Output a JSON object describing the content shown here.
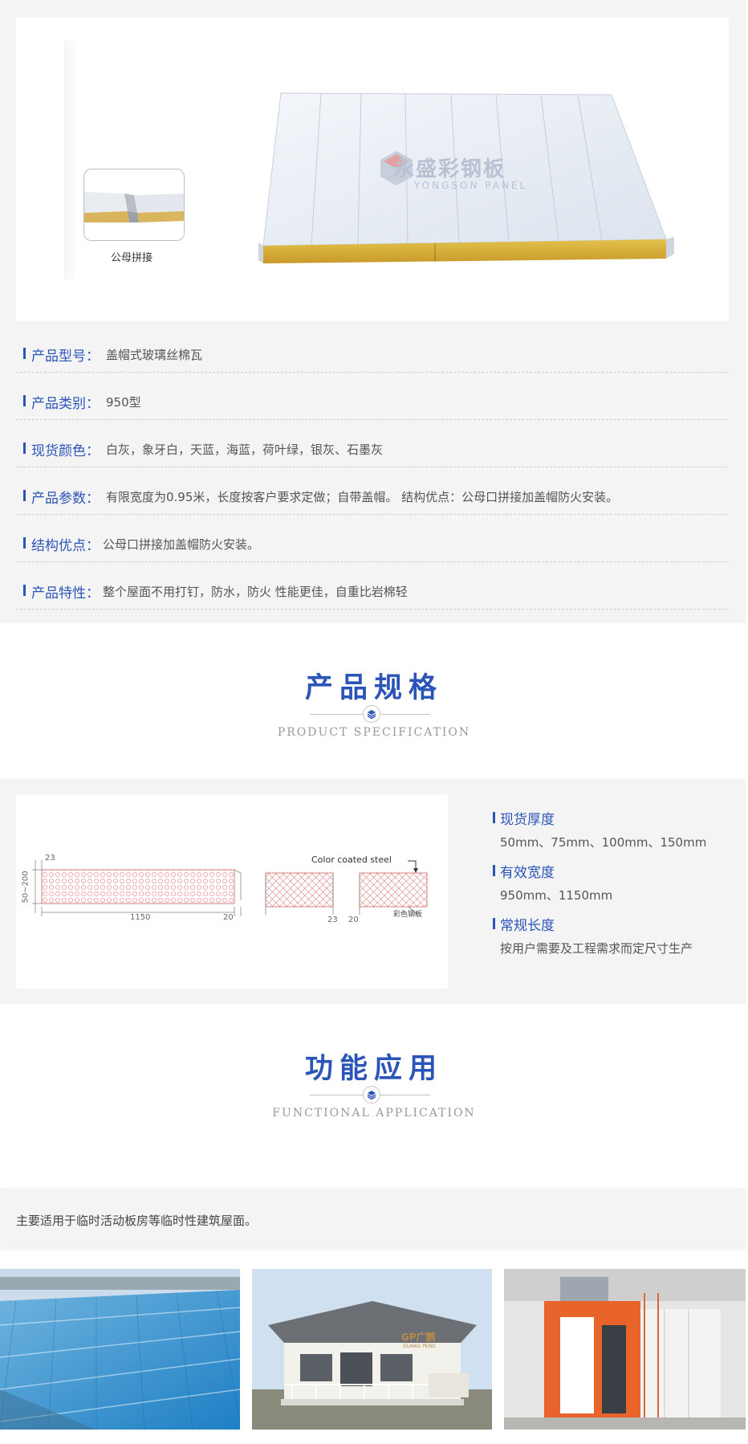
{
  "product_image": {
    "watermark_cn": "永盛彩钢板",
    "watermark_en": "YONGSON PANEL",
    "inset_caption": "公母拼接"
  },
  "specs": [
    {
      "label": "产品型号：",
      "value": "盖帽式玻璃丝棉瓦"
    },
    {
      "label": "产品类别：",
      "value": "950型"
    },
    {
      "label": "现货颜色：",
      "value": "白灰，象牙白，天蓝，海蓝，荷叶绿，银灰、石墨灰"
    },
    {
      "label": "产品参数：",
      "value": "有限宽度为0.95米，长度按客户要求定做；自带盖帽。 结构优点：公母口拼接加盖帽防火安装。"
    },
    {
      "label": "结构优点：",
      "value": "公母口拼接加盖帽防火安装。"
    },
    {
      "label": "产品特性：",
      "value": "整个屋面不用打钉，防水，防火 性能更佳，自重比岩棉轻"
    }
  ],
  "spec_heading": {
    "cn": "产品规格",
    "en": "PRODUCT SPECIFICATION"
  },
  "diagram": {
    "dim_23_top": "23",
    "dim_50_200": "50~200",
    "dim_1150": "1150",
    "dim_20_left": "20",
    "color_coated_steel": "Color coated steel",
    "dim_23_mid": "23",
    "dim_20_right": "20",
    "cn_label": "彩色钢板"
  },
  "right_specs": [
    {
      "label": "现货厚度",
      "value": "50mm、75mm、100mm、150mm"
    },
    {
      "label": "有效宽度",
      "value": "950mm、1150mm"
    },
    {
      "label": "常规长度",
      "value": "按用户需要及工程需求而定尺寸生产"
    }
  ],
  "app_heading": {
    "cn": "功能应用",
    "en": "FUNCTIONAL APPLICATION"
  },
  "application_text": "主要适用于临时活动板房等临时性建筑屋面。",
  "photos": {
    "house_sign": "GP广鹏",
    "house_sign_en": "GUANG PENG"
  },
  "colors": {
    "accent": "#2b54b8",
    "panel_bg": "#f4f4f4"
  }
}
